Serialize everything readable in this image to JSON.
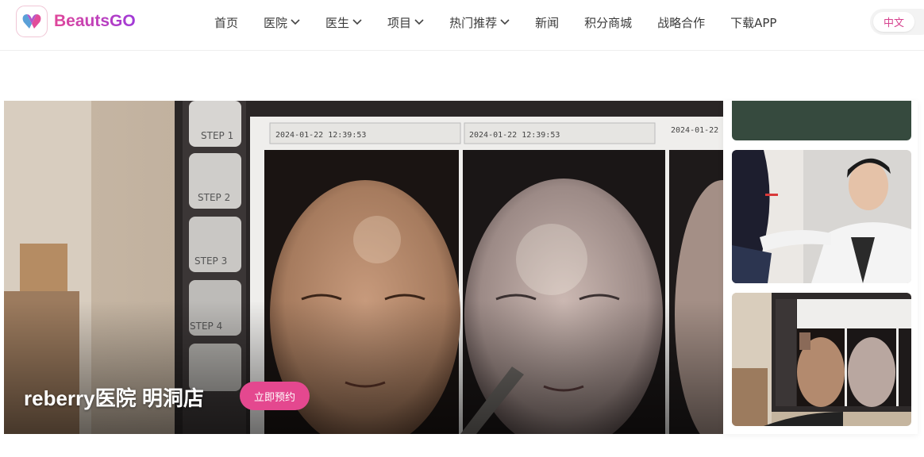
{
  "brand": {
    "name": "BeautsGO",
    "accent": "#e0479a",
    "accent2": "#a03ad8"
  },
  "nav": [
    {
      "label": "首页",
      "dropdown": false
    },
    {
      "label": "医院",
      "dropdown": true
    },
    {
      "label": "医生",
      "dropdown": true
    },
    {
      "label": "项目",
      "dropdown": true
    },
    {
      "label": "热门推荐",
      "dropdown": true
    },
    {
      "label": "新闻",
      "dropdown": false
    },
    {
      "label": "积分商城",
      "dropdown": false
    },
    {
      "label": "战略合作",
      "dropdown": false
    },
    {
      "label": "下载APP",
      "dropdown": false
    }
  ],
  "language": {
    "current": "中文"
  },
  "hero": {
    "title": "reberry医院 明洞店",
    "cta": "立即预约",
    "screen_labels": [
      "STEP 1",
      "STEP 2",
      "STEP 3",
      "STEP 4"
    ],
    "screen_timestamps": [
      "2024-01-22 12:39:53",
      "2024-01-22 12:39:53",
      "2024-01-22"
    ]
  },
  "colors": {
    "cta": "#e4488f",
    "thumb_dark": "#364a3e"
  }
}
